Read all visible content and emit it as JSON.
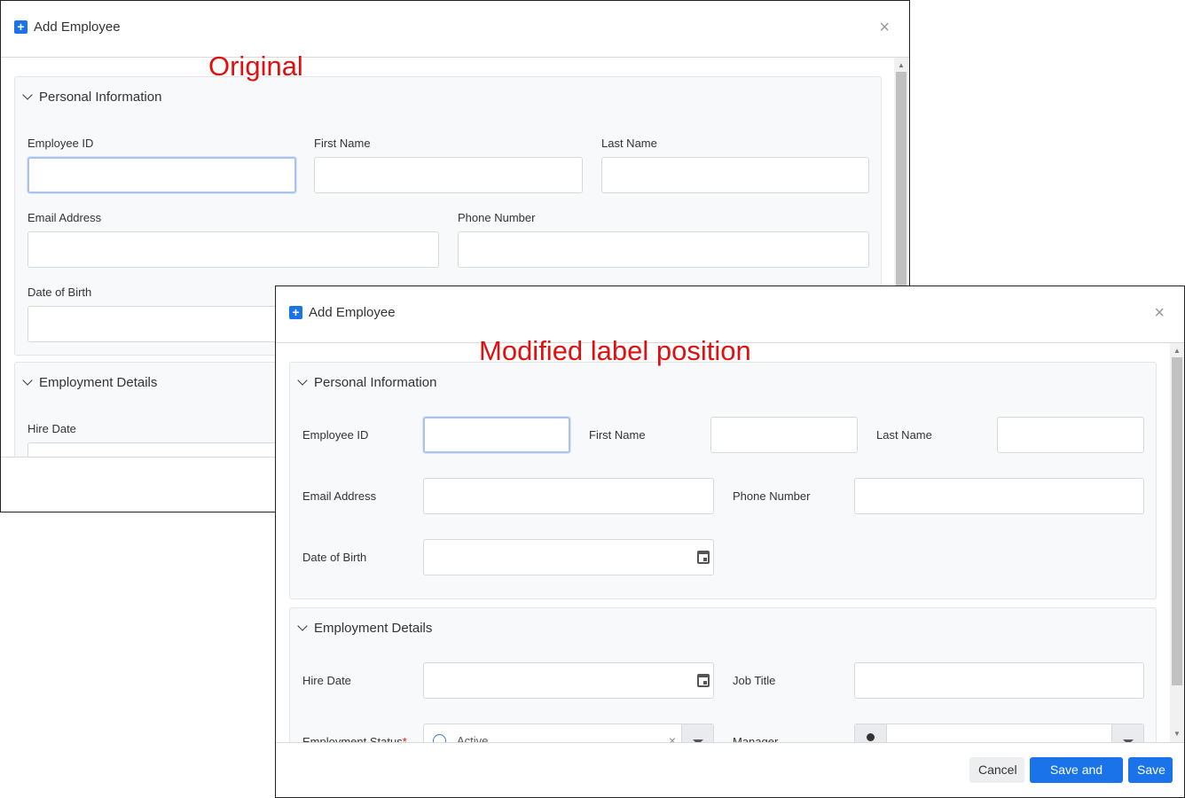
{
  "original": {
    "annotation": "Original",
    "dialog_title": "Add Employee",
    "close_glyph": "×",
    "sections": {
      "personal": {
        "title": "Personal Information",
        "employee_id_label": "Employee ID",
        "first_name_label": "First Name",
        "last_name_label": "Last Name",
        "email_label": "Email Address",
        "phone_label": "Phone Number",
        "dob_label": "Date of Birth"
      },
      "employment": {
        "title": "Employment Details",
        "hire_date_label": "Hire Date"
      }
    }
  },
  "modified": {
    "annotation": "Modified label position",
    "dialog_title": "Add Employee",
    "close_glyph": "×",
    "sections": {
      "personal": {
        "title": "Personal Information",
        "employee_id_label": "Employee ID",
        "first_name_label": "First Name",
        "last_name_label": "Last Name",
        "email_label": "Email Address",
        "phone_label": "Phone Number",
        "dob_label": "Date of Birth"
      },
      "employment": {
        "title": "Employment Details",
        "hire_date_label": "Hire Date",
        "job_title_label": "Job Title",
        "status_label": "Employment Status",
        "required_mark": "*",
        "status_value": "Active",
        "status_clear": "×",
        "manager_label": "Manager"
      }
    },
    "footer": {
      "cancel": "Cancel",
      "save_and_new": "Save and New",
      "save": "Save"
    }
  },
  "icons": {
    "dialog": "plus-square-icon",
    "close": "close-icon",
    "section": "chevron-down-icon",
    "date": "calendar-icon",
    "manager": "person-icon",
    "dropdown": "caret-down-icon"
  },
  "colors": {
    "accent": "#1a73e8",
    "annotation": "#e01010",
    "section_bg": "#f8f9fb",
    "focus_border": "#a9c3ec"
  }
}
